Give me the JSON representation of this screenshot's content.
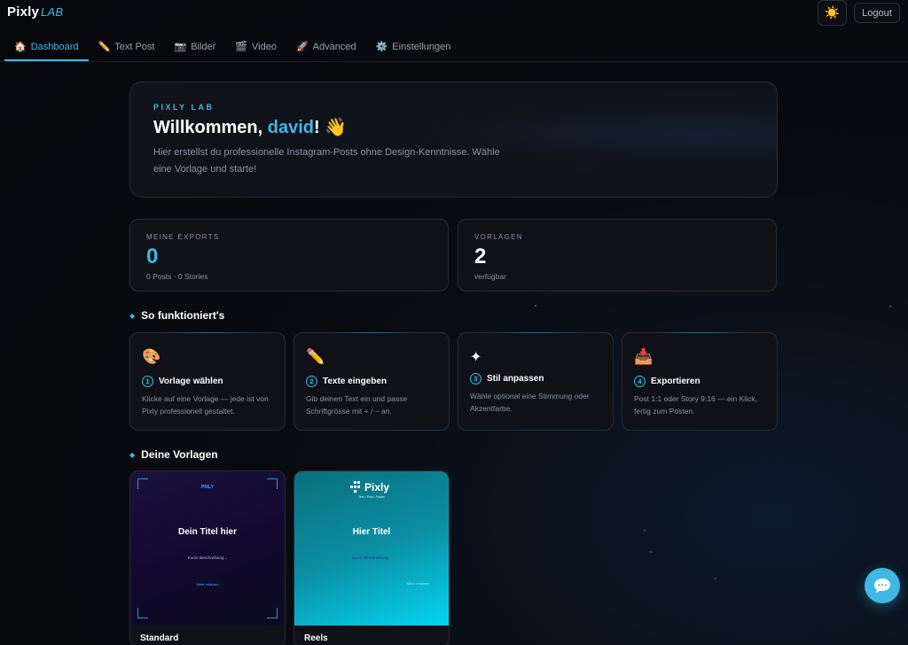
{
  "header": {
    "logo_main": "Pixly",
    "logo_sub": "LAB",
    "theme_icon": "☀️",
    "logout_label": "Logout"
  },
  "tabs": [
    {
      "icon": "🏠",
      "label": "Dashboard",
      "active": true
    },
    {
      "icon": "✏️",
      "label": "Text Post"
    },
    {
      "icon": "📷",
      "label": "Bilder"
    },
    {
      "icon": "🎬",
      "label": "Video"
    },
    {
      "icon": "🚀",
      "label": "Advanced"
    },
    {
      "icon": "⚙️",
      "label": "Einstellungen"
    }
  ],
  "hero": {
    "kicker": "PIXLY LAB",
    "greeting": "Willkommen, ",
    "name": "david",
    "greeting_end": "! 👋",
    "text": "Hier erstellst du professionelle Instagram-Posts ohne Design-Kenntnisse. Wähle eine Vorlage und starte!"
  },
  "stats": [
    {
      "label": "MEINE EXPORTS",
      "value": "0",
      "sub": "0 Posts · 0 Stories",
      "color": "#3fb8e6"
    },
    {
      "label": "VORLAGEN",
      "value": "2",
      "sub": "verfügbar",
      "color": "#ffffff"
    }
  ],
  "how": {
    "title": "So funktioniert's",
    "steps": [
      {
        "icon": "🎨",
        "num": "1",
        "title": "Vorlage wählen",
        "desc": "Klicke auf eine Vorlage — jede ist von Pixly professionell gestaltet."
      },
      {
        "icon": "✏️",
        "num": "2",
        "title": "Texte eingeben",
        "desc": "Gib deinen Text ein und passe Schriftgrösse mit + / − an."
      },
      {
        "icon": "✦",
        "num": "3",
        "title": "Stil anpassen",
        "desc": "Wähle optional eine Stimmung oder Akzentfarbe."
      },
      {
        "icon": "📥",
        "num": "4",
        "title": "Exportieren",
        "desc": "Post 1:1 oder Story 9:16 — ein Klick, fertig zum Posten."
      }
    ]
  },
  "templates": {
    "title": "Deine Vorlagen",
    "items": [
      {
        "name": "Standard",
        "preview_logo": "PIXLY",
        "preview_title": "Dein Titel hier",
        "preview_sub": "Kurze Beschreibung...",
        "preview_link": "Mehr erfahren"
      },
      {
        "name": "Reels",
        "preview_logo": "Pixly",
        "preview_tagline": "Text • Post • Faster",
        "preview_title": "Hier Titel",
        "preview_sub": "Kurze Beschreibung...",
        "preview_link": "Mehr erfahren"
      }
    ]
  },
  "colors": {
    "accent": "#3fb8e6",
    "background": "#07080c",
    "card": "#0f1117"
  }
}
